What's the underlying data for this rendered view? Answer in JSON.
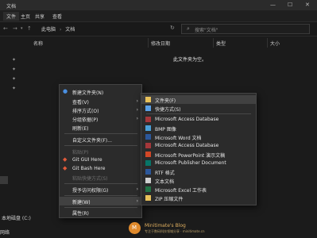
{
  "window": {
    "title": "文档",
    "min": "—",
    "max": "☐",
    "close": "✕"
  },
  "ribbon": {
    "tabs": [
      "文件",
      "主页",
      "共享",
      "查看"
    ]
  },
  "address": {
    "path": [
      "此电脑",
      "文档"
    ],
    "search_placeholder": "搜索\"文档\""
  },
  "columns": [
    "名称",
    "修改日期",
    "类型",
    "大小"
  ],
  "empty_message": "此文件夹为空。",
  "nav": {
    "drive_label": "本地磁盘 (C:)",
    "bottom_label": "网络"
  },
  "context_menu": {
    "items": [
      {
        "label": "新建文件夹(N)",
        "icon": "new-folder-icon"
      },
      {
        "label": "查看(V)",
        "submenu": true
      },
      {
        "label": "排序方式(O)",
        "submenu": true
      },
      {
        "label": "分组依据(P)",
        "submenu": true
      },
      {
        "label": "刷新(E)"
      },
      {
        "label": "自定义文件夹(F)..."
      },
      {
        "label": "粘贴(P)",
        "disabled": true
      },
      {
        "label": "Git GUI Here",
        "icon": "git-gui-icon"
      },
      {
        "label": "Git Bash Here",
        "icon": "git-bash-icon"
      },
      {
        "label": "粘贴快捷方式(S)",
        "disabled": true
      },
      {
        "label": "授予访问权限(G)",
        "submenu": true
      },
      {
        "label": "新建(W)",
        "submenu": true,
        "highlighted": true
      },
      {
        "label": "属性(R)"
      }
    ]
  },
  "new_submenu": {
    "items": [
      {
        "label": "文件夹(F)",
        "icon": "folder-icon",
        "color": "#e8c15a"
      },
      {
        "label": "快捷方式(S)",
        "icon": "shortcut-icon",
        "color": "#5aa0e8"
      },
      {
        "label": "Microsoft Access Database",
        "icon": "access-icon",
        "color": "#a4373a"
      },
      {
        "label": "BMP 图像",
        "icon": "bmp-image-icon",
        "color": "#4aa0d8"
      },
      {
        "label": "Microsoft Word 文档",
        "icon": "word-icon",
        "color": "#2b579a"
      },
      {
        "label": "Microsoft Access Database",
        "icon": "access-icon",
        "color": "#a4373a"
      },
      {
        "label": "Microsoft PowerPoint 演示文稿",
        "icon": "powerpoint-icon",
        "color": "#d24726"
      },
      {
        "label": "Microsoft Publisher Document",
        "icon": "publisher-icon",
        "color": "#077568"
      },
      {
        "label": "RTF 格式",
        "icon": "rtf-icon",
        "color": "#2b579a"
      },
      {
        "label": "文本文档",
        "icon": "text-document-icon",
        "color": "#d0d0d0"
      },
      {
        "label": "Microsoft Excel 工作表",
        "icon": "excel-icon",
        "color": "#217346"
      },
      {
        "label": "ZIP 压缩文件",
        "icon": "zip-icon",
        "color": "#e8c15a"
      }
    ]
  },
  "watermark": {
    "logo_letter": "M",
    "name": "Minitimate's Blog",
    "subtitle": "专注于数码科技领域分享 · minitimate.cn"
  }
}
